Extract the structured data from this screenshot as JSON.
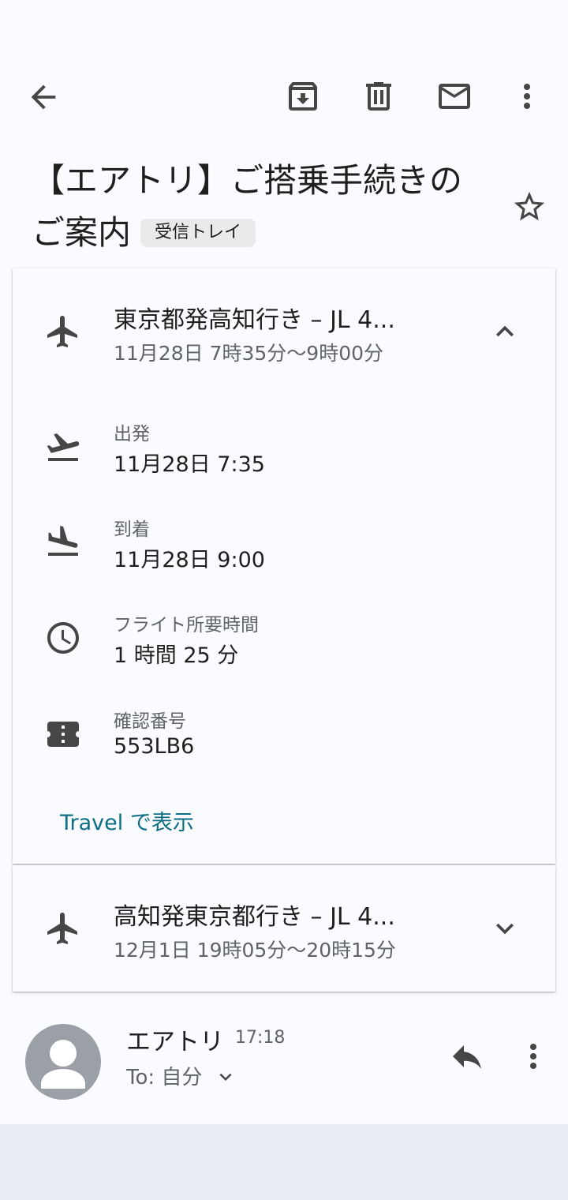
{
  "toolbar": {
    "icons": [
      "back-arrow-icon",
      "archive-icon",
      "delete-icon",
      "mark-unread-icon",
      "more-vert-icon"
    ]
  },
  "email": {
    "subject_line1": "【エアトリ】ご搭乗手続きの",
    "subject_line2": "ご案内",
    "label": "受信トレイ",
    "starred": false
  },
  "flights": [
    {
      "title": "東京都発高知行き – JL 4...",
      "time": "11月28日 7時35分～9時00分",
      "expanded": true,
      "details": {
        "departure_label": "出発",
        "departure_value": "11月28日 7:35",
        "arrival_label": "到着",
        "arrival_value": "11月28日 9:00",
        "duration_label": "フライト所要時間",
        "duration_value": "1 時間 25 分",
        "confirmation_label": "確認番号",
        "confirmation_value": "553LB6"
      },
      "link": "Travel で表示"
    },
    {
      "title": "高知発東京都行き – JL 4...",
      "time": "12月1日 19時05分～20時15分",
      "expanded": false
    }
  ],
  "sender": {
    "name": "エアトリ",
    "time": "17:18",
    "to": "To: 自分"
  },
  "colors": {
    "background": "#fafbfe",
    "icon": "#444746",
    "link": "#0b6e86",
    "avatar": "#9aa0a6"
  }
}
